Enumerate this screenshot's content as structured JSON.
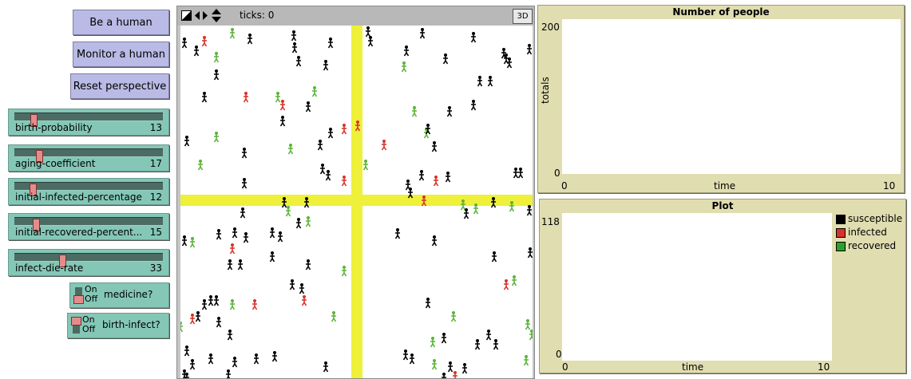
{
  "buttons": {
    "be_human": "Be a human",
    "monitor_human": "Monitor a human",
    "reset_perspective": "Reset perspective"
  },
  "sliders": [
    {
      "label": "birth-probability",
      "value": "13",
      "level": 0.13
    },
    {
      "label": "aging-coefficient",
      "value": "17",
      "level": 0.17
    },
    {
      "label": "initial-infected-percentage",
      "value": "12",
      "level": 0.12
    },
    {
      "label": "initial-recovered-percent...",
      "value": "15",
      "level": 0.15
    },
    {
      "label": "infect-die-rate",
      "value": "33",
      "level": 0.33
    }
  ],
  "switches": [
    {
      "on_label": "On",
      "off_label": "Off",
      "label": "medicine?",
      "state": "off"
    },
    {
      "on_label": "On",
      "off_label": "Off",
      "label": "birth-infect?",
      "state": "on"
    }
  ],
  "view": {
    "ticks_label": "ticks: 0",
    "three_d": "3D",
    "colors": {
      "road": "#eef03a",
      "background": "#ffffff"
    }
  },
  "plots": {
    "people": {
      "title": "Number of people",
      "ylabel": "totals",
      "xlabel": "time",
      "y_max": "200",
      "y_min": "0",
      "x_min": "0",
      "x_max": "10"
    },
    "plot": {
      "title": "Plot",
      "xlabel": "time",
      "y_max": "118",
      "y_min": "0",
      "x_min": "0",
      "x_max": "10",
      "legend": [
        {
          "label": "susceptible",
          "color": "#000000"
        },
        {
          "label": "infected",
          "color": "#d73229"
        },
        {
          "label": "recovered",
          "color": "#2ca02c"
        }
      ]
    }
  }
}
